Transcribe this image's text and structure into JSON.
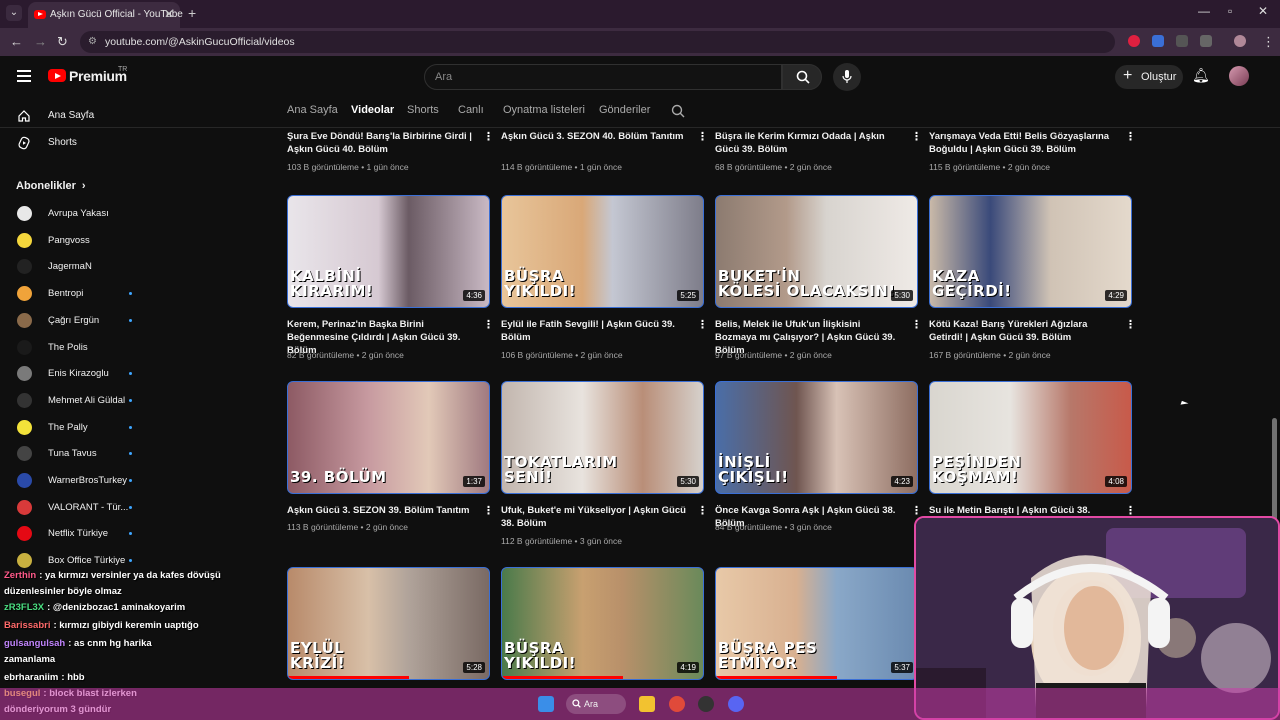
{
  "browser": {
    "tab_title": "Aşkın Gücü Official - YouTube",
    "url": "youtube.com/@AskinGucuOfficial/videos"
  },
  "header": {
    "brand": "Premium",
    "region": "TR",
    "search_placeholder": "Ara",
    "create_label": "Oluştur"
  },
  "sidebar": {
    "nav": [
      {
        "label": "Ana Sayfa",
        "icon": "home-icon"
      },
      {
        "label": "Shorts",
        "icon": "shorts-icon"
      }
    ],
    "subs_title": "Abonelikler",
    "subscriptions": [
      {
        "label": "Avrupa Yakası",
        "color": "#e8e8e8",
        "live": false
      },
      {
        "label": "Pangvoss",
        "color": "#f4d63c",
        "live": false
      },
      {
        "label": "JagermaN",
        "color": "#222222",
        "live": false
      },
      {
        "label": "Bentropi",
        "color": "#f0a33a",
        "live": true
      },
      {
        "label": "Çağrı Ergün",
        "color": "#8a6a4a",
        "live": true
      },
      {
        "label": "The Polis",
        "color": "#1a1a1a",
        "live": false
      },
      {
        "label": "Enis Kirazoglu",
        "color": "#7a7a7a",
        "live": true
      },
      {
        "label": "Mehmet Ali Güldal",
        "color": "#333333",
        "live": true
      },
      {
        "label": "The Pally",
        "color": "#f2e23a",
        "live": true
      },
      {
        "label": "Tuna Tavus",
        "color": "#444444",
        "live": true
      },
      {
        "label": "WarnerBrosTurkey",
        "color": "#2a4aa8",
        "live": true
      },
      {
        "label": "VALORANT - Tür...",
        "color": "#d83a3a",
        "live": true
      },
      {
        "label": "Netflix Türkiye",
        "color": "#e50914",
        "live": true
      },
      {
        "label": "Box Office Türkiye",
        "color": "#c8b040",
        "live": true
      }
    ]
  },
  "channel_tabs": [
    "Ana Sayfa",
    "Videolar",
    "Shorts",
    "Canlı",
    "Oynatma listeleri",
    "Gönderiler"
  ],
  "active_tab": "Videolar",
  "top_row": [
    {
      "title": "Şura Eve Döndü! Barış'la Birbirine Girdi | Aşkın Gücü 40. Bölüm",
      "meta": "103 B görüntüleme • 1 gün önce"
    },
    {
      "title": "Aşkın Gücü 3. SEZON 40. Bölüm Tanıtım",
      "meta": "114 B görüntüleme • 1 gün önce"
    },
    {
      "title": "Büşra ile Kerim Kırmızı Odada | Aşkın Gücü 39. Bölüm",
      "meta": "68 B görüntüleme • 2 gün önce"
    },
    {
      "title": "Yarışmaya Veda Etti! Belis Gözyaşlarına Boğuldu | Aşkın Gücü 39. Bölüm",
      "meta": "115 B görüntüleme • 2 gün önce"
    }
  ],
  "videos": [
    {
      "overlay1": "KALBİNİ",
      "overlay2": "KIRARIM!",
      "duration": "4:36",
      "title": "Kerem, Perinaz'ın Başka Birini Beğenmesine Çıldırdı | Aşkın Gücü 39. Bölüm",
      "meta": "82 B görüntüleme • 2 gün önce",
      "bg": "linear-gradient(90deg,#e9e5ea 0%,#d6c9d2 45%,#6b5b64 60%,#c9b9c4 100%)",
      "progress": 0
    },
    {
      "overlay1": "BÜŞRA",
      "overlay2": "YIKILDI!",
      "duration": "5:25",
      "title": "Eylül ile Fatih Sevgili! | Aşkın Gücü 39. Bölüm",
      "meta": "106 B görüntüleme • 2 gün önce",
      "bg": "linear-gradient(90deg,#e8c59a 0%,#d9a878 40%,#c4c7d2 55%,#7e7d8a 100%)",
      "progress": 0
    },
    {
      "overlay1": "BUKET'İN",
      "overlay2": "KÖLESİ OLACAKSIN!",
      "duration": "5:30",
      "title": "Belis, Melek ile Ufuk'un İlişkisini Bozmaya mı Çalışıyor? | Aşkın Gücü 39. Bölüm",
      "meta": "97 B görüntüleme • 2 gün önce",
      "bg": "linear-gradient(90deg,#8c7b70 0%,#b29a8a 35%,#d8d4cf 55%,#efeae6 100%)",
      "progress": 0
    },
    {
      "overlay1": "KAZA",
      "overlay2": "GEÇİRDİ!",
      "duration": "4:29",
      "title": "Kötü Kaza! Barış Yürekleri Ağızlara Getirdi! | Aşkın Gücü 39. Bölüm",
      "meta": "167 B görüntüleme • 2 gün önce",
      "bg": "linear-gradient(90deg,#c9b9a8 0%,#3a4a7a 30%,#d0c3b5 60%,#e4d9cc 100%)",
      "progress": 0
    },
    {
      "overlay1": "",
      "overlay2": "39. BÖLÜM",
      "duration": "1:37",
      "title": "Aşkın Gücü 3. SEZON 39. Bölüm Tanıtım",
      "meta": "113 B görüntüleme • 2 gün önce",
      "bg": "linear-gradient(90deg,#8d5a64 0%,#c79aa0 40%,#e2c9b8 70%,#a07a80 100%)",
      "progress": 0
    },
    {
      "overlay1": "TOKATLARIM",
      "overlay2": "SENİ!",
      "duration": "5:30",
      "title": "Ufuk, Buket'e mi Yükseliyor | Aşkın Gücü 38. Bölüm",
      "meta": "112 B görüntüleme • 3 gün önce",
      "bg": "linear-gradient(90deg,#c2b6ae 0%,#e8e3de 40%,#b98e78 70%,#d6d1cc 100%)",
      "progress": 0
    },
    {
      "overlay1": "İNİŞLİ",
      "overlay2": "ÇIKIŞLI!",
      "duration": "4:23",
      "title": "Önce Kavga Sonra Aşk | Aşkın Gücü 38. Bölüm",
      "meta": "84 B görüntüleme • 3 gün önce",
      "bg": "linear-gradient(90deg,#4a6ea8 0%,#6f5550 40%,#d8c2b6 60%,#8e6e62 100%)",
      "progress": 0
    },
    {
      "overlay1": "PEŞİNDEN",
      "overlay2": "KOŞMAM!",
      "duration": "4:08",
      "title": "Su ile Metin Barıştı | Aşkın Gücü 38. Bölüm",
      "meta": "",
      "bg": "linear-gradient(90deg,#d9d6cf 0%,#e7e4df 40%,#b7786a 70%,#c85a4a 100%)",
      "progress": 0
    },
    {
      "overlay1": "EYLÜL",
      "overlay2": "KRİZİ!",
      "duration": "5:28",
      "title": "",
      "meta": "",
      "bg": "linear-gradient(90deg,#b88a6a 0%,#d8c0a8 40%,#b0a39a 60%,#7a6a64 100%)",
      "progress": 0.6
    },
    {
      "overlay1": "BÜŞRA",
      "overlay2": "YIKILDI!",
      "duration": "4:19",
      "title": "",
      "meta": "",
      "bg": "linear-gradient(90deg,#4a7a4a 0%,#c8a070 40%,#b8906a 60%,#6a8a5a 100%)",
      "progress": 0.6
    },
    {
      "overlay1": "BÜŞRA PES",
      "overlay2": "ETMİYOR",
      "duration": "5:37",
      "title": "",
      "meta": "",
      "bg": "linear-gradient(90deg,#e8c9a8 0%,#d8b090 40%,#8aa8c8 60%,#6a8ab0 100%)",
      "progress": 0.6
    }
  ],
  "chat": [
    {
      "user": "Zerthin",
      "text": ": ya kırmızı versinler ya da kafes dövüşü",
      "color": "#ff5a8a"
    },
    {
      "user": "",
      "text": "düzenlesinler böyle olmaz",
      "color": "#ffffff"
    },
    {
      "user": "zR3FL3X",
      "text": ": @denizbozac1 aminakoyarim",
      "color": "#4ade80"
    },
    {
      "user": "Barissabri",
      "text": ": kırmızı gibiydi keremin uaptığo",
      "color": "#ff6a6a"
    },
    {
      "user": "gulsangulsah",
      "text": ": as cnm hg harika",
      "color": "#c084fc"
    },
    {
      "user": "",
      "text": "zamanlama",
      "color": "#ffffff"
    },
    {
      "user": "ebrharaniim",
      "text": ": hbb",
      "color": "#ffffff"
    },
    {
      "user": "busegul",
      "text": ": block blast izlerken",
      "color": "#fde047"
    },
    {
      "user": "",
      "text": "dönderiyorum 3 gündür",
      "color": "#ffffff"
    }
  ],
  "taskbar": {
    "search_label": "Ara"
  }
}
